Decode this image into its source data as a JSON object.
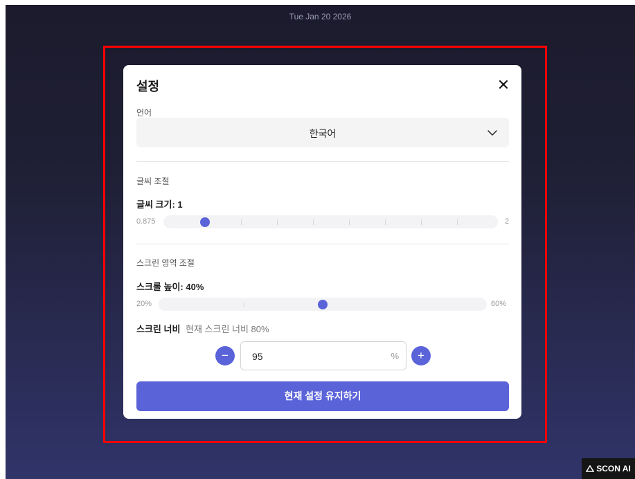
{
  "date": "Tue Jan 20 2026",
  "modal": {
    "title": "설정",
    "language_label": "언어",
    "language_value": "한국어",
    "font_section_label": "글씨 조절",
    "font_size_label": "글씨 크기: 1",
    "font_slider": {
      "min_label": "0.875",
      "max_label": "2",
      "min": 0.875,
      "max": 2,
      "value": 1
    },
    "screen_section_label": "스크린 영역 조절",
    "scroll_height_label": "스크롤 높이: 40%",
    "scroll_slider": {
      "min_label": "20%",
      "max_label": "60%",
      "min": 20,
      "max": 60,
      "value": 40
    },
    "screen_width_label": "스크린 너비",
    "screen_width_current": "현재 스크린 너비 80%",
    "width_value": "95",
    "width_unit": "%",
    "decrement": "−",
    "increment": "+",
    "keep_button": "현재 설정 유지하기"
  },
  "watermark": "SCON AI",
  "colors": {
    "accent": "#5b63d9",
    "highlight": "#ff0000"
  },
  "icons": [
    "close-icon",
    "chevron-down-icon",
    "minus-icon",
    "plus-icon",
    "scon-logo-icon"
  ]
}
